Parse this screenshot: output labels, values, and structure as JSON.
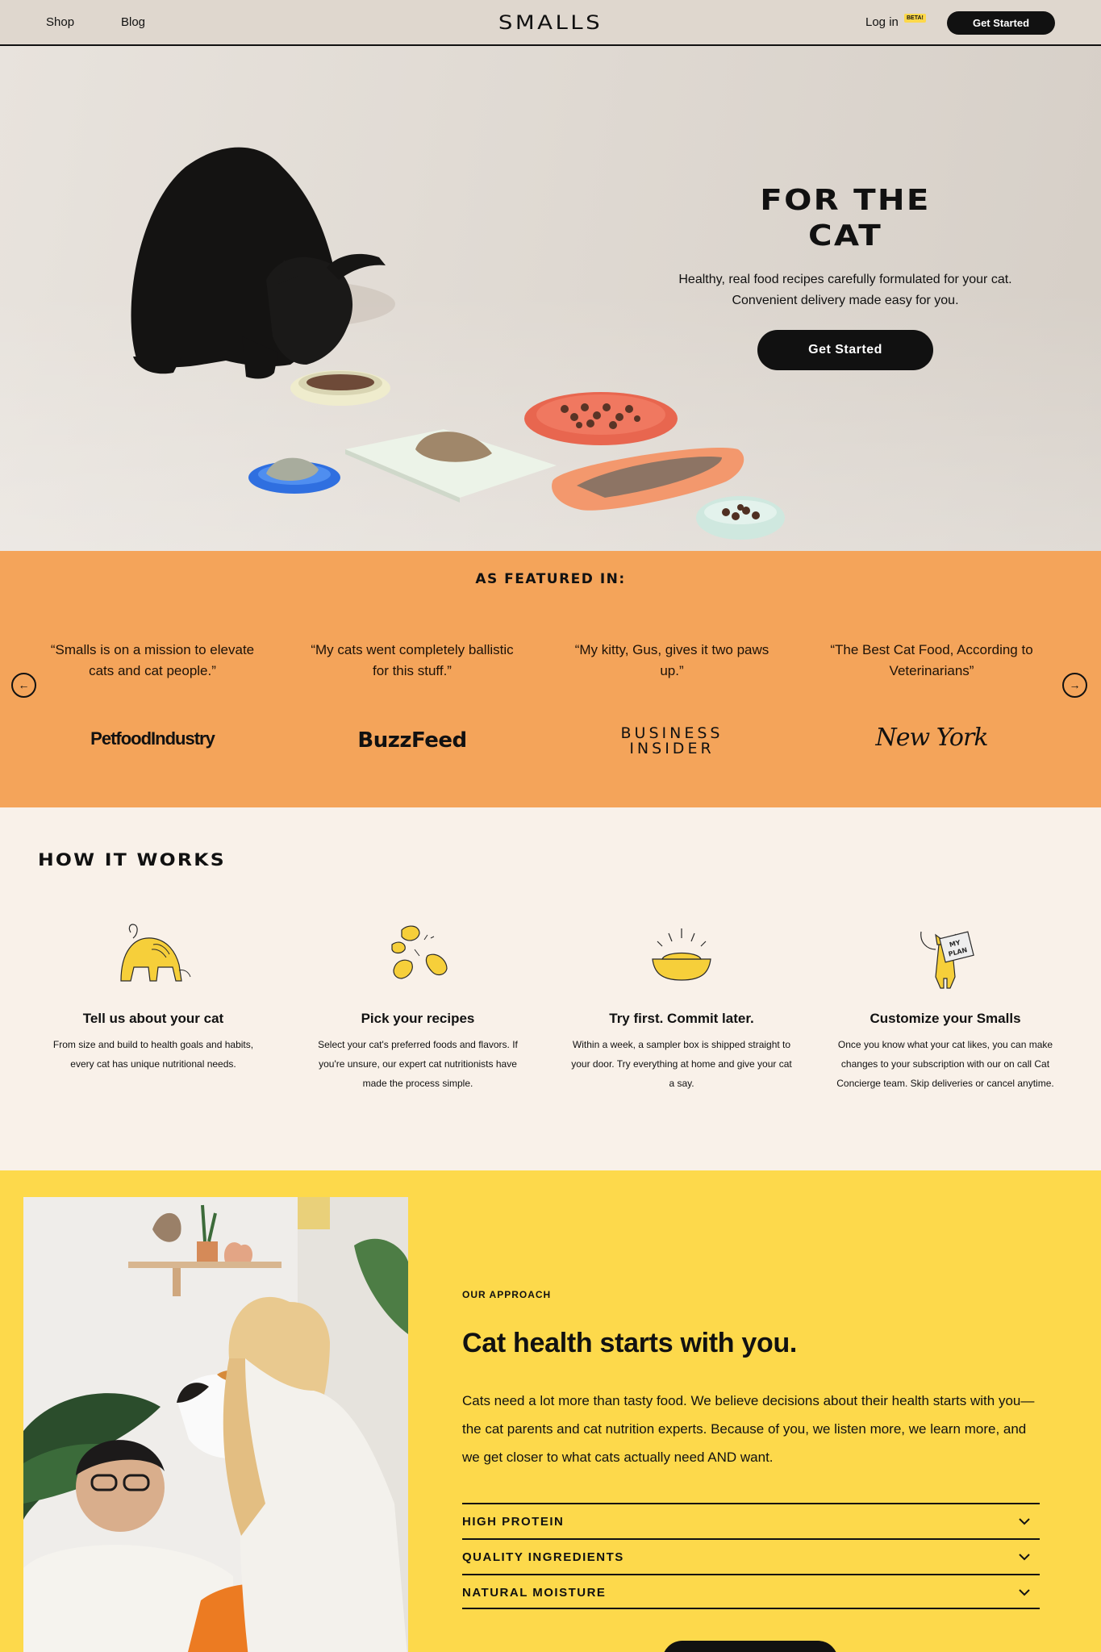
{
  "nav": {
    "links": [
      "Shop",
      "Blog"
    ],
    "logo": "SMALLS",
    "login": "Log in",
    "beta_badge": "BETA!",
    "cta": "Get Started"
  },
  "hero": {
    "title": "FOR THE CAT",
    "subtitle": "Healthy, real food recipes carefully formulated for your cat. Convenient delivery made easy for you.",
    "cta": "Get Started"
  },
  "featured": {
    "title": "AS FEATURED IN:",
    "items": [
      {
        "quote": "“Smalls is on a mission to elevate cats and cat people.”",
        "publication": "PetfoodIndustry"
      },
      {
        "quote": "“My cats went completely ballistic for this stuff.”",
        "publication": "BuzzFeed"
      },
      {
        "quote": "“My kitty, Gus, gives it two paws up.”",
        "publication": "BUSINESS INSIDER"
      },
      {
        "quote": "“The Best Cat Food, According to Veterinarians”",
        "publication": "New York"
      }
    ],
    "prev_icon": "arrow-left-icon",
    "next_icon": "arrow-right-icon"
  },
  "how": {
    "title": "HOW IT WORKS",
    "steps": [
      {
        "icon": "cat-stretch-icon",
        "title": "Tell us about your cat",
        "desc": "From size and build to health goals and habits, every cat has unique nutritional needs."
      },
      {
        "icon": "food-pieces-icon",
        "title": "Pick your recipes",
        "desc": "Select your cat's preferred foods and flavors. If you're unsure, our expert cat nutritionists have made the process simple."
      },
      {
        "icon": "food-bowl-icon",
        "title": "Try first. Commit later.",
        "desc": "Within a week, a sampler box is shipped straight to your door. Try everything at home and give your cat a say."
      },
      {
        "icon": "cat-my-plan-icon",
        "title": "Customize your Smalls",
        "desc": "Once you know what your cat likes, you can make changes to your subscription with our on call Cat Concierge team. Skip deliveries or cancel anytime."
      }
    ]
  },
  "approach": {
    "eyebrow": "OUR APPROACH",
    "headline": "Cat health starts with you.",
    "body": "Cats need a lot more than tasty food. We believe decisions about their health starts with you—the cat parents and cat nutrition experts. Because of you, we listen more, we learn more, and we get closer to what cats actually need AND want.",
    "accordion": [
      "HIGH PROTEIN",
      "QUALITY INGREDIENTS",
      "NATURAL MOISTURE"
    ]
  },
  "colors": {
    "featured_bg": "#f4a45a",
    "how_bg": "#f9f1e9",
    "approach_bg": "#fdd94b",
    "illustration_yellow": "#f6cf3a",
    "button": "#111111"
  }
}
